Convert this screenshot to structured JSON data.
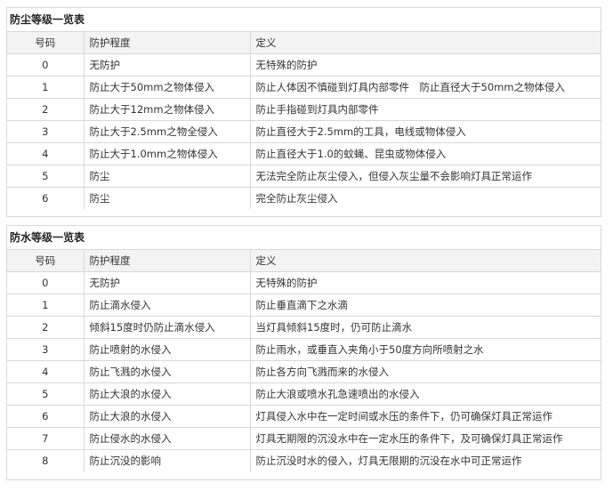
{
  "dust": {
    "title": "防尘等级一览表",
    "headers": [
      "号码",
      "防护程度",
      "定义"
    ],
    "rows": [
      [
        "0",
        "无防护",
        "无特殊的防护"
      ],
      [
        "1",
        "防止大于50mm之物体侵入",
        "防止人体因不慎碰到灯具内部零件　防止直径大于50mm之物体侵入"
      ],
      [
        "2",
        "防止大于12mm之物体侵入",
        "防止手指碰到灯具内部零件"
      ],
      [
        "3",
        "防止大于2.5mm之物全侵入",
        "防止直径大于2.5mm的工具，电线或物体侵入"
      ],
      [
        "4",
        "防止大于1.0mm之物体侵入",
        "防止直径大于1.0的蚊蝇、昆虫或物体侵入"
      ],
      [
        "5",
        "防尘",
        "无法完全防止灰尘侵入，但侵入灰尘量不会影响灯具正常运作"
      ],
      [
        "6",
        "防尘",
        "完全防止灰尘侵入"
      ]
    ]
  },
  "water": {
    "title": "防水等级一览表",
    "headers": [
      "号码",
      "防护程度",
      "定义"
    ],
    "rows": [
      [
        "0",
        "无防护",
        "无特殊的防护"
      ],
      [
        "1",
        "防止滴水侵入",
        "防止垂直滴下之水滴"
      ],
      [
        "2",
        "倾斜15度时仍防止滴水侵入",
        "当灯具倾斜15度时，仍可防止滴水"
      ],
      [
        "3",
        "防止喷射的水侵入",
        "防止雨水，或垂直入夹角小于50度方向所喷射之水"
      ],
      [
        "4",
        "防止飞溅的水侵入",
        "防止各方向飞溅而来的水侵入"
      ],
      [
        "5",
        "防止大浪的水侵入",
        "防止大浪或喷水孔急速喷出的水侵入"
      ],
      [
        "6",
        "防止大浪的水侵入",
        "灯具侵入水中在一定时间或水压的条件下，仍可确保灯具正常运作"
      ],
      [
        "7",
        "防止侵水的水侵入",
        "灯具无期限的沉没水中在一定水压的条件下，及可确保灯具正常运作"
      ],
      [
        "8",
        "防止沉没的影响",
        "防止沉没时水的侵入，灯具无限期的沉没在水中可正常运作"
      ]
    ]
  }
}
